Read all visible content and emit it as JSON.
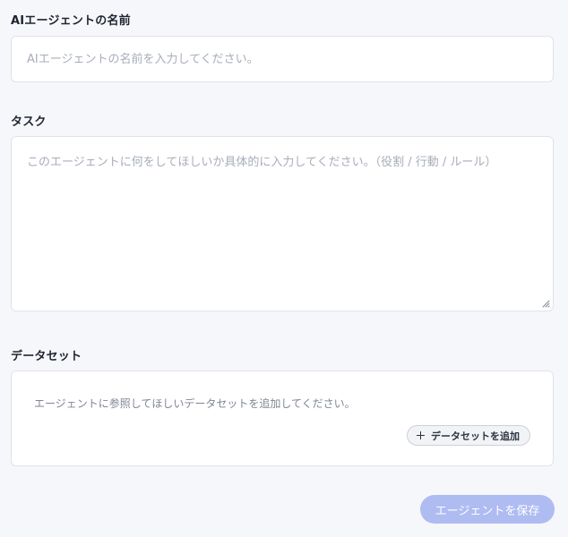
{
  "agent_name": {
    "label": "AIエージェントの名前",
    "value": "",
    "placeholder": "AIエージェントの名前を入力してください。"
  },
  "task": {
    "label": "タスク",
    "value": "",
    "placeholder": "このエージェントに何をしてほしいか具体的に入力してください。（役割 / 行動 / ルール）"
  },
  "dataset": {
    "label": "データセット",
    "help_text": "エージェントに参照してほしいデータセットを追加してください。",
    "add_button_label": "データセットを追加",
    "add_button_icon": "plus-icon"
  },
  "actions": {
    "save_label": "エージェントを保存",
    "save_disabled": true
  },
  "colors": {
    "page_background": "#f6f7fa",
    "field_border": "#dfe3ea",
    "save_button_disabled": "#aebcf2"
  }
}
